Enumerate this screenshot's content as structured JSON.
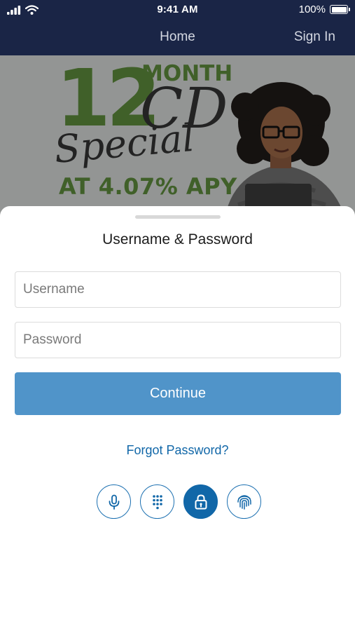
{
  "status_bar": {
    "time": "9:41 AM",
    "battery_text": "100%",
    "battery_level": 1.0
  },
  "nav": {
    "title": "Home",
    "sign_in": "Sign In"
  },
  "banner": {
    "number": "12",
    "month": "MONTH",
    "cd": "CD",
    "special": "Special",
    "rate": "AT 4.07% APY"
  },
  "sheet": {
    "title": "Username & Password",
    "username_placeholder": "Username",
    "password_placeholder": "Password",
    "continue_label": "Continue",
    "forgot_label": "Forgot Password?"
  },
  "auth_methods": [
    {
      "icon": "microphone-icon",
      "active": false
    },
    {
      "icon": "keypad-icon",
      "active": false
    },
    {
      "icon": "lock-icon",
      "active": true
    },
    {
      "icon": "fingerprint-icon",
      "active": false
    }
  ],
  "colors": {
    "header_bg": "#1a2546",
    "primary_button": "#5094c9",
    "link": "#1167a8",
    "banner_green": "#5c8a3c"
  }
}
